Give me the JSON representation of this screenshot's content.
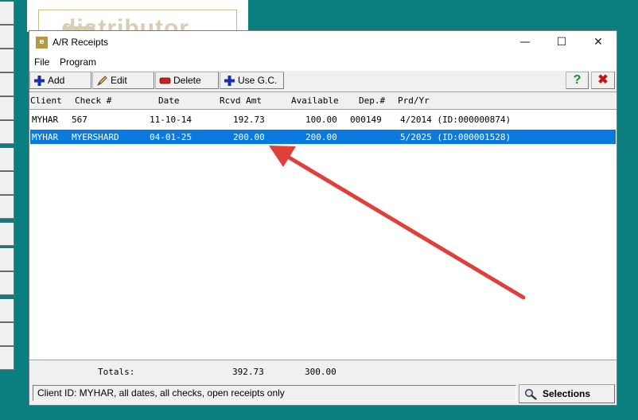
{
  "background": {
    "logo_text": "distributor"
  },
  "window": {
    "title": "A/R Receipts",
    "app_icon_text": "e",
    "controls": {
      "minimize": "—",
      "maximize": "☐",
      "close": "✕"
    }
  },
  "menu": {
    "items": [
      "File",
      "Program"
    ]
  },
  "toolbar": {
    "add_label": "Add",
    "edit_label": "Edit",
    "delete_label": "Delete",
    "use_gc_label": "Use G.C.",
    "help_label": "?",
    "exit_label": "✖"
  },
  "table": {
    "columns": [
      "Client",
      "Check #",
      "Date",
      "Rcvd Amt",
      "Available",
      "Dep.#",
      "Prd/Yr"
    ],
    "rows": [
      {
        "client": "MYHAR",
        "check": "567",
        "date": "11-10-14",
        "rcvd_amt": "192.73",
        "available": "100.00",
        "dep": "000149",
        "prd_yr": "4/2014 (ID:000000874)",
        "selected": false
      },
      {
        "client": "MYHAR",
        "check": "MYERSHARD",
        "date": "04-01-25",
        "rcvd_amt": "200.00",
        "available": "200.00",
        "dep": "",
        "prd_yr": "5/2025 (ID:000001528)",
        "selected": true
      }
    ]
  },
  "totals": {
    "label": "Totals:",
    "rcvd_amt": "392.73",
    "available": "300.00"
  },
  "status": {
    "text": "Client ID: MYHAR, all dates, all checks, open receipts only"
  },
  "selections_button": {
    "label": "Selections"
  },
  "colors": {
    "background": "#0b7f7f",
    "selection": "#0a7ae0",
    "annotation_arrow": "#e0403a"
  }
}
